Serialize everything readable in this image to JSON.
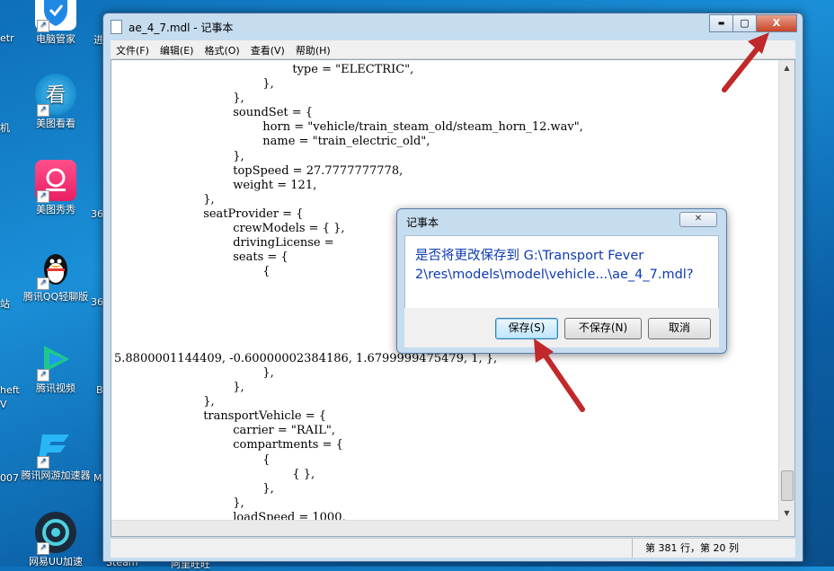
{
  "desktop": {
    "icons": [
      {
        "label": "电脑管家"
      },
      {
        "label": "美图看看"
      },
      {
        "label": "美图秀秀"
      },
      {
        "label": "腾讯QQ轻聊版"
      },
      {
        "label": "腾讯视频"
      },
      {
        "label": "腾讯网游加速器"
      },
      {
        "label": "网易UU加速"
      }
    ],
    "edge_labels": [
      "etr",
      "机",
      "站",
      "heft",
      "V",
      "007",
      "进",
      "36",
      "36",
      "B",
      "M",
      "Steam",
      "阿里旺旺"
    ]
  },
  "notepad": {
    "title": "ae_4_7.mdl - 记事本",
    "min_label": "▬",
    "max_label": "▢",
    "close_label": "X",
    "menu": [
      "文件(F)",
      "编辑(E)",
      "格式(O)",
      "查看(V)",
      "帮助(H)"
    ],
    "code": "\t\t\t\t\t\ttype = \"ELECTRIC\",\n\t\t\t\t\t},\n\t\t\t\t},\n\t\t\t\tsoundSet = {\n\t\t\t\t\thorn = \"vehicle/train_steam_old/steam_horn_12.wav\",\n\t\t\t\t\tname = \"train_electric_old\",\n\t\t\t\t},\n\t\t\t\ttopSpeed = 27.7777777778,\n\t\t\t\tweight = 121,\n\t\t\t},\n\t\t\tseatProvider = {\n\t\t\t\tcrewModels = { },\n\t\t\t\tdrivingLicense = \n\t\t\t\tseats = {\n\t\t\t\t\t{\n\n\n\n\n\n5.8800001144409, -0.60000002384186, 1.6799999475479, 1, },\n\t\t\t\t\t},\n\t\t\t\t},\n\t\t\t},\n\t\t\ttransportVehicle = {\n\t\t\t\tcarrier = \"RAIL\",\n\t\t\t\tcompartments = {\n\t\t\t\t\t{\n\t\t\t\t\t\t{ },\n\t\t\t\t\t},\n\t\t\t\t},\n\t\t\t\tloadSpeed = 1000,",
    "status": "第 381 行，第 20 列"
  },
  "dialog": {
    "title": "记事本",
    "close_label": "✕",
    "message": "是否将更改保存到 G:\\Transport Fever 2\\res\\models\\model\\vehicle...\\ae_4_7.mdl?",
    "buttons": {
      "save": "保存(S)",
      "dont_save": "不保存(N)",
      "cancel": "取消"
    }
  },
  "colors": {
    "arrow": "#c0282a",
    "message": "#0f3bb3",
    "desktop": "#1a8fd8"
  }
}
